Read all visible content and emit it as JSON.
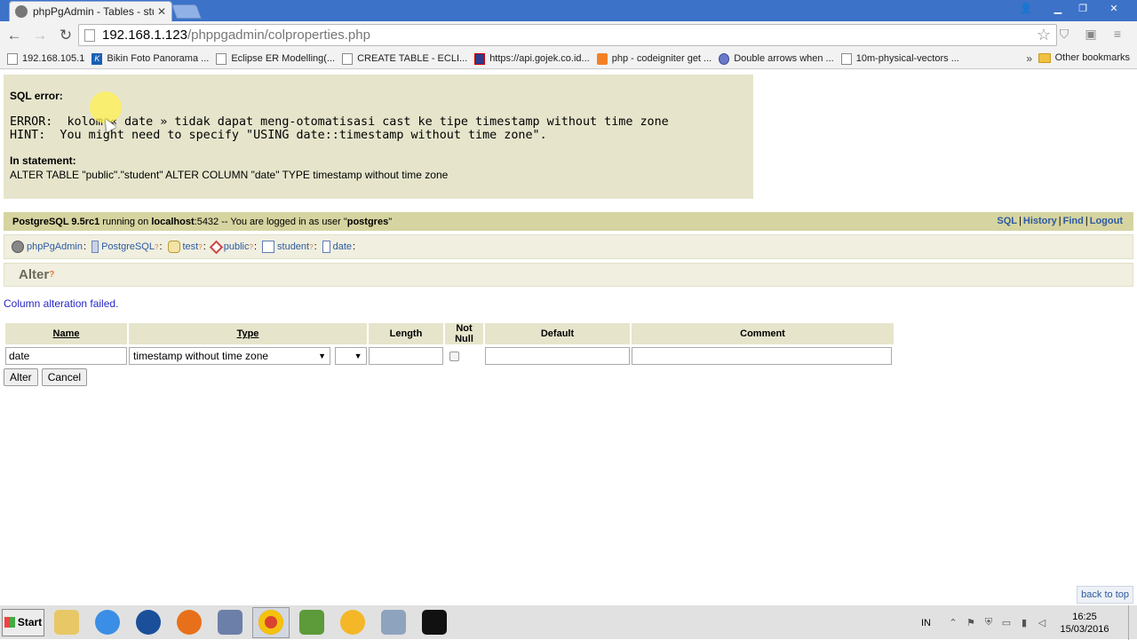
{
  "browser": {
    "tab_title": "phpPgAdmin - Tables - stude",
    "url_host": "192.168.1.123",
    "url_path": "/phppgadmin/colproperties.php",
    "bookmarks": [
      {
        "label": "192.168.105.1",
        "icon": "page"
      },
      {
        "label": "Bikin Foto Panorama ...",
        "icon": "k"
      },
      {
        "label": "Eclipse ER Modelling(...",
        "icon": "page"
      },
      {
        "label": "CREATE TABLE - ECLI...",
        "icon": "page"
      },
      {
        "label": "https://api.gojek.co.id...",
        "icon": "api"
      },
      {
        "label": "php - codeigniter get ...",
        "icon": "so"
      },
      {
        "label": "Double arrows when ...",
        "icon": "circ"
      },
      {
        "label": "10m-physical-vectors ...",
        "icon": "page"
      }
    ],
    "more_bookmarks": "»",
    "other_bookmarks": "Other bookmarks"
  },
  "sql_error": {
    "title": "SQL error:",
    "error_line": "ERROR:  kolom « date » tidak dapat meng-otomatisasi cast ke tipe timestamp without time zone",
    "hint_line": "HINT:  You might need to specify \"USING date::timestamp without time zone\".",
    "statement_title": "In statement:",
    "statement": "ALTER TABLE \"public\".\"student\" ALTER COLUMN \"date\" TYPE timestamp without time zone"
  },
  "topbar": {
    "server": "PostgreSQL 9.5rc1",
    "running_on": " running on ",
    "host": "localhost",
    "port_text": ":5432 -- You are logged in as user \"",
    "user": "postgres",
    "end_quote": "\"",
    "links": [
      "SQL",
      "History",
      "Find",
      "Logout"
    ]
  },
  "trail": {
    "items": [
      {
        "label": "phpPgAdmin",
        "help": ""
      },
      {
        "label": "PostgreSQL",
        "help": "?"
      },
      {
        "label": "test",
        "help": "?"
      },
      {
        "label": "public",
        "help": "?"
      },
      {
        "label": "student",
        "help": "?"
      },
      {
        "label": "date",
        "help": ""
      }
    ]
  },
  "page": {
    "title": "Alter",
    "title_help": "?",
    "message": "Column alteration failed."
  },
  "form": {
    "headers": {
      "name": "Name",
      "type": "Type",
      "length": "Length",
      "not_null": "Not Null",
      "default": "Default",
      "comment": "Comment"
    },
    "name_value": "date",
    "type_value": "timestamp without time zone",
    "array_value": "",
    "length_value": "",
    "not_null": false,
    "default_value": "",
    "comment_value": "",
    "alter_label": "Alter",
    "cancel_label": "Cancel"
  },
  "footer": {
    "back_to_top": "back to top"
  },
  "taskbar": {
    "start_label": "Start",
    "lang": "IN",
    "time": "16:25",
    "date": "15/03/2016"
  },
  "colors": {
    "error_bg": "#e6e5cc",
    "topbar_bg": "#d6d4a0",
    "link": "#2d5aa0",
    "message": "#2727c5",
    "titlebar": "#3c72c8"
  }
}
